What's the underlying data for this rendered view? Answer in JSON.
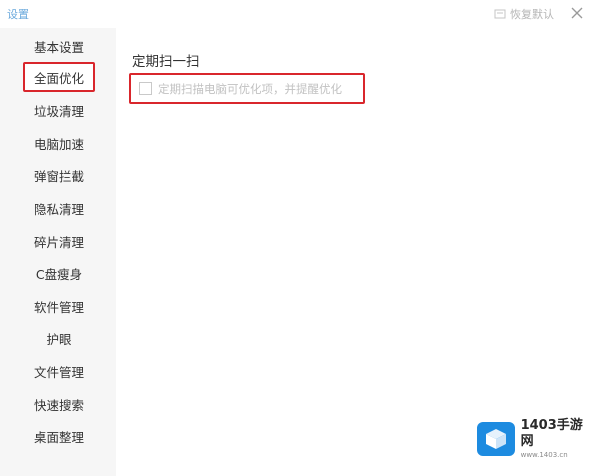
{
  "window": {
    "title": "设置",
    "restore_label": "恢复默认",
    "icons": {
      "restore": "restore-icon",
      "close": "close-icon"
    }
  },
  "sidebar": {
    "items": [
      {
        "label": "基本设置",
        "active": false
      },
      {
        "label": "全面优化",
        "active": true
      },
      {
        "label": "垃圾清理",
        "active": false
      },
      {
        "label": "电脑加速",
        "active": false
      },
      {
        "label": "弹窗拦截",
        "active": false
      },
      {
        "label": "隐私清理",
        "active": false
      },
      {
        "label": "碎片清理",
        "active": false
      },
      {
        "label": "C盘瘦身",
        "active": false
      },
      {
        "label": "软件管理",
        "active": false
      },
      {
        "label": "护眼",
        "active": false
      },
      {
        "label": "文件管理",
        "active": false
      },
      {
        "label": "快速搜索",
        "active": false
      },
      {
        "label": "桌面整理",
        "active": false
      }
    ]
  },
  "main": {
    "section_title": "定期扫一扫",
    "option": {
      "label": "定期扫描电脑可优化项，并提醒优化",
      "checked": false
    }
  },
  "watermark": {
    "name": "1403手游网",
    "url": "www.1403.cn"
  },
  "colors": {
    "accent_red": "#d9262c",
    "title_blue": "#6aa9dc",
    "sidebar_bg": "#f6f6f6",
    "watermark_blue": "#1d8be0"
  }
}
